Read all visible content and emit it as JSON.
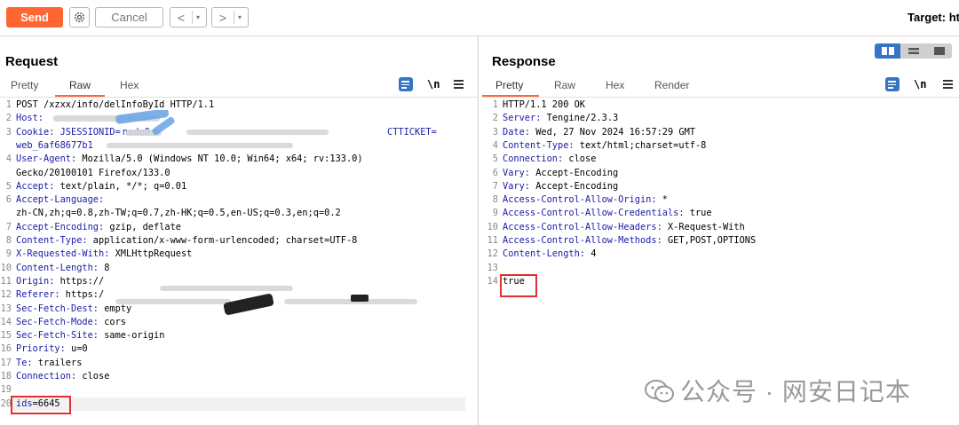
{
  "toolbar": {
    "send_label": "Send",
    "cancel_label": "Cancel",
    "back_label": "<",
    "forward_label": ">",
    "dropdown_label": "▾",
    "target_label": "Target: ht"
  },
  "request": {
    "title": "Request",
    "tabs": [
      "Pretty",
      "Raw",
      "Hex"
    ],
    "active_tab": "Raw",
    "lines": [
      {
        "n": "1",
        "k": "",
        "v": "POST /xzxx/info/delInfoById HTTP/1.1"
      },
      {
        "n": "2",
        "k": "Host:",
        "v": ""
      },
      {
        "n": "3",
        "k": "Cookie: JSESSIONID=",
        "v": ""
      },
      {
        "n": "",
        "k": "web_6af68677b1",
        "v": ""
      },
      {
        "n": "4",
        "k": "User-Agent:",
        "v": " Mozilla/5.0 (Windows NT 10.0; Win64; x64; rv:133.0)"
      },
      {
        "n": "",
        "k": "",
        "v": "Gecko/20100101 Firefox/133.0"
      },
      {
        "n": "5",
        "k": "Accept:",
        "v": " text/plain, */*; q=0.01"
      },
      {
        "n": "6",
        "k": "Accept-Language:",
        "v": ""
      },
      {
        "n": "",
        "k": "",
        "v": "zh-CN,zh;q=0.8,zh-TW;q=0.7,zh-HK;q=0.5,en-US;q=0.3,en;q=0.2"
      },
      {
        "n": "7",
        "k": "Accept-Encoding:",
        "v": " gzip, deflate"
      },
      {
        "n": "8",
        "k": "Content-Type:",
        "v": " application/x-www-form-urlencoded; charset=UTF-8"
      },
      {
        "n": "9",
        "k": "X-Requested-With:",
        "v": " XMLHttpRequest"
      },
      {
        "n": "10",
        "k": "Content-Length:",
        "v": " 8"
      },
      {
        "n": "11",
        "k": "Origin:",
        "v": " https://"
      },
      {
        "n": "12",
        "k": "Referer:",
        "v": " https:/"
      },
      {
        "n": "13",
        "k": "Sec-Fetch-Dest:",
        "v": " empty"
      },
      {
        "n": "14",
        "k": "Sec-Fetch-Mode:",
        "v": " cors"
      },
      {
        "n": "15",
        "k": "Sec-Fetch-Site:",
        "v": " same-origin"
      },
      {
        "n": "16",
        "k": "Priority:",
        "v": " u=0"
      },
      {
        "n": "17",
        "k": "Te:",
        "v": " trailers"
      },
      {
        "n": "18",
        "k": "Connection:",
        "v": " close"
      },
      {
        "n": "19",
        "k": "",
        "v": ""
      },
      {
        "n": "20",
        "k": "ids",
        "v": "=6645"
      }
    ],
    "cookie_tail_key": "CTTICKET=",
    "cookie_node_key": "node0"
  },
  "response": {
    "title": "Response",
    "tabs": [
      "Pretty",
      "Raw",
      "Hex",
      "Render"
    ],
    "active_tab": "Pretty",
    "lines": [
      {
        "n": "1",
        "k": "",
        "v": "HTTP/1.1 200 OK"
      },
      {
        "n": "2",
        "k": "Server:",
        "v": " Tengine/2.3.3"
      },
      {
        "n": "3",
        "k": "Date:",
        "v": " Wed, 27 Nov 2024 16:57:29 GMT"
      },
      {
        "n": "4",
        "k": "Content-Type:",
        "v": " text/html;charset=utf-8"
      },
      {
        "n": "5",
        "k": "Connection:",
        "v": " close"
      },
      {
        "n": "6",
        "k": "Vary:",
        "v": " Accept-Encoding"
      },
      {
        "n": "7",
        "k": "Vary:",
        "v": " Accept-Encoding"
      },
      {
        "n": "8",
        "k": "Access-Control-Allow-Origin:",
        "v": " *"
      },
      {
        "n": "9",
        "k": "Access-Control-Allow-Credentials:",
        "v": " true"
      },
      {
        "n": "10",
        "k": "Access-Control-Allow-Headers:",
        "v": " X-Request-With"
      },
      {
        "n": "11",
        "k": "Access-Control-Allow-Methods:",
        "v": " GET,POST,OPTIONS"
      },
      {
        "n": "12",
        "k": "Content-Length:",
        "v": " 4"
      },
      {
        "n": "13",
        "k": "",
        "v": ""
      },
      {
        "n": "14",
        "k": "",
        "v": "true"
      }
    ]
  },
  "icons": {
    "format": "\\n",
    "menu": "menu-icon"
  },
  "colors": {
    "accent": "#ff6633",
    "header_key": "#1b1ba8",
    "highlight_box": "#e03030",
    "layout_active": "#3575c4"
  },
  "watermark": "公众号 · 网安日记本"
}
